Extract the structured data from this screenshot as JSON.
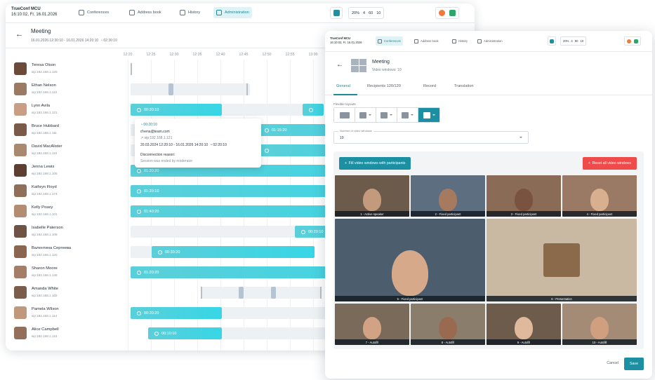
{
  "back_app": {
    "brand_name": "TrueConf MCU",
    "brand_time": "16:10:02, Fr, 16.01.2026",
    "nav": [
      {
        "label": "Conferences",
        "icon": "conference-icon"
      },
      {
        "label": "Address book",
        "icon": "address-book-icon"
      },
      {
        "label": "History",
        "icon": "history-icon"
      },
      {
        "label": "Administration",
        "icon": "administration-icon"
      }
    ],
    "stats": {
      "cpu": "20%",
      "users": "4",
      "participants": "60",
      "rooms": "10"
    },
    "meeting_title": "Meeting",
    "meeting_range": "16.01.2026 12:30:10 - 16.01.2026 14:20:10",
    "meeting_duration": "02:30:10",
    "timeline_ticks": [
      "12:20",
      "12:25",
      "12:30",
      "12:35",
      "12:40",
      "12:45",
      "12:50",
      "12:55",
      "13:00"
    ],
    "participants": [
      {
        "name": "Teresa Olson",
        "sip": "sip:192.168.1.125"
      },
      {
        "name": "Ethan Nelson",
        "sip": "sip:192.168.1.110"
      },
      {
        "name": "Lynn Avila",
        "sip": "sip:192.168.1.121",
        "bar": "00:20:10"
      },
      {
        "name": "Bruce Hubbard",
        "sip": "sip:192.168.1.111",
        "bar": "01:15:20"
      },
      {
        "name": "David MacAlister",
        "sip": "sip:192.168.1.110"
      },
      {
        "name": "Jenna Lewis",
        "sip": "sip:192.168.1.105",
        "bar": "01:20:20"
      },
      {
        "name": "Kathryn Floyd",
        "sip": "sip:192.168.1.174",
        "bar": "01:20:10"
      },
      {
        "name": "Kelly Posey",
        "sip": "sip:192.168.1.101",
        "bar": "01:40:20"
      },
      {
        "name": "Isabelle Paterson",
        "sip": "sip:192.168.1.106",
        "bar": "00:20:10"
      },
      {
        "name": "Валентина Сергеева",
        "sip": "sip:192.168.1.120",
        "bar": "00:30:20"
      },
      {
        "name": "Sharon Moore",
        "sip": "sip:192.168.1.148",
        "bar": "01:20:20"
      },
      {
        "name": "Amanda White",
        "sip": "sip:192.168.1.102"
      },
      {
        "name": "Pamela Wilson",
        "sip": "sip:192.168.1.114",
        "bar": "00:20:20"
      },
      {
        "name": "Alice Campbell",
        "sip": "sip:192.168.1.113",
        "bar": "00:10:10"
      }
    ],
    "popup": {
      "duration": "00:20:10",
      "email": "d'vena@team.com",
      "sip": "sip:192.168.1.121",
      "range": "20.03.2024 12:20:10 - 16.01.2026 14:20:10",
      "range_duration": "02:20:10",
      "reason_title": "Disconnection reason:",
      "reason_text": "Session was ended by moderator"
    }
  },
  "front_app": {
    "brand_name": "TrueConf MCU",
    "brand_time": "16:10:02, Fr, 16.01.2026",
    "nav": [
      {
        "label": "Conferences"
      },
      {
        "label": "Address book"
      },
      {
        "label": "History"
      },
      {
        "label": "Administration"
      }
    ],
    "stats": {
      "cpu": "20%",
      "users": "4",
      "participants": "60",
      "rooms": "10"
    },
    "title": "Meeting",
    "subtitle": "Video windows: 10",
    "tabs": [
      "General",
      "Recipients 120/120",
      "Record",
      "Translation"
    ],
    "flexible_layouts_label": "Flexible layouts",
    "number_label": "Number of video windows",
    "number_value": "10",
    "fill_button": "Fill video windows with participants",
    "reset_button": "Reset all video windows",
    "tiles": [
      "1 - Active speaker",
      "2 - Fixed participant",
      "3 - Fixed participant",
      "4 - Fixed participant",
      "5 - Fixed participant",
      "6 - Presentation",
      "7 - Autofill",
      "8 - Autofill",
      "9 - Autofill",
      "10 - Autofill"
    ],
    "cancel": "Cancel",
    "save": "Save"
  },
  "colors": {
    "accent": "#1d8fa2",
    "bar": "#37d6e6",
    "danger": "#ef4b4b"
  }
}
